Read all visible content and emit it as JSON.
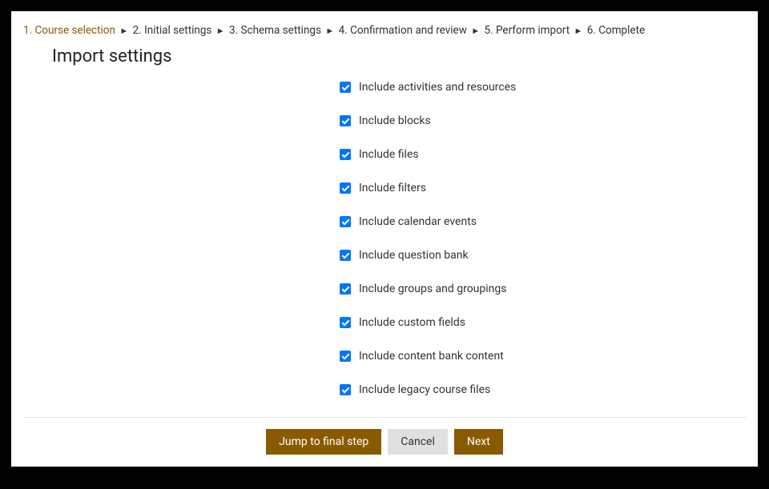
{
  "breadcrumb": {
    "steps": [
      {
        "label": "1. Course selection",
        "current": true
      },
      {
        "label": "2. Initial settings",
        "current": false
      },
      {
        "label": "3. Schema settings",
        "current": false
      },
      {
        "label": "4. Confirmation and review",
        "current": false
      },
      {
        "label": "5. Perform import",
        "current": false
      },
      {
        "label": "6. Complete",
        "current": false
      }
    ]
  },
  "page_title": "Import settings",
  "settings": [
    {
      "id": "activities",
      "label": "Include activities and resources",
      "checked": true
    },
    {
      "id": "blocks",
      "label": "Include blocks",
      "checked": true
    },
    {
      "id": "files",
      "label": "Include files",
      "checked": true
    },
    {
      "id": "filters",
      "label": "Include filters",
      "checked": true
    },
    {
      "id": "calendar",
      "label": "Include calendar events",
      "checked": true
    },
    {
      "id": "questionbank",
      "label": "Include question bank",
      "checked": true
    },
    {
      "id": "groups",
      "label": "Include groups and groupings",
      "checked": true
    },
    {
      "id": "customfields",
      "label": "Include custom fields",
      "checked": true
    },
    {
      "id": "contentbank",
      "label": "Include content bank content",
      "checked": true
    },
    {
      "id": "legacy",
      "label": "Include legacy course files",
      "checked": true
    }
  ],
  "buttons": {
    "jump": "Jump to final step",
    "cancel": "Cancel",
    "next": "Next"
  }
}
